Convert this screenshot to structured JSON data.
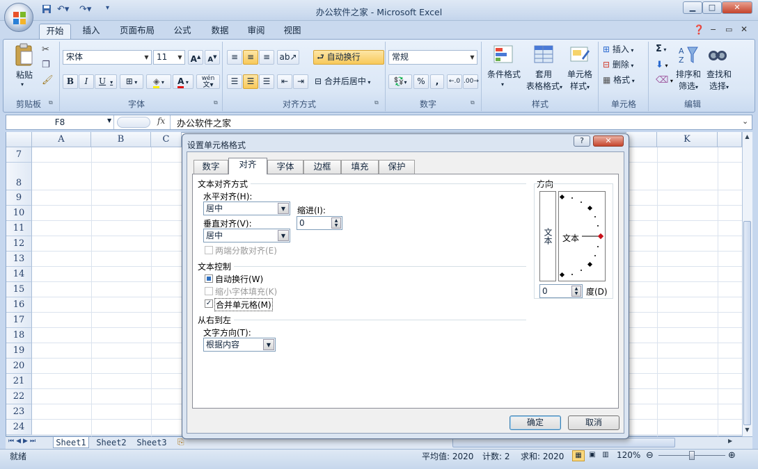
{
  "window": {
    "title": "办公软件之家 - Microsoft Excel"
  },
  "ribbon_tabs": [
    "开始",
    "插入",
    "页面布局",
    "公式",
    "数据",
    "审阅",
    "视图"
  ],
  "clipboard": {
    "paste": "粘贴",
    "group": "剪贴板"
  },
  "font": {
    "name": "宋体",
    "size": "11",
    "bold": "B",
    "italic": "I",
    "underline": "U",
    "phonetic": "wén",
    "group": "字体"
  },
  "alignment": {
    "wrap": "自动换行",
    "merge": "合并后居中",
    "group": "对齐方式"
  },
  "number": {
    "format": "常规",
    "percent": "%",
    "comma": ",",
    "group": "数字"
  },
  "styles": {
    "conditional1": "条件格式",
    "table1": "套用",
    "table2": "表格格式",
    "cell1": "单元格",
    "cell2": "样式",
    "group": "样式"
  },
  "cells": {
    "insert": "插入",
    "delete": "删除",
    "format": "格式",
    "group": "单元格"
  },
  "editing": {
    "sigma": "Σ",
    "sort1": "排序和",
    "sort2": "筛选",
    "find1": "查找和",
    "find2": "选择",
    "group": "编辑"
  },
  "formula_bar": {
    "name_box": "F8",
    "fx": "fx",
    "content": "办公软件之家"
  },
  "columns": [
    "A",
    "B",
    "C",
    "K"
  ],
  "rows": [
    "7",
    "8",
    "9",
    "10",
    "11",
    "12",
    "13",
    "14",
    "15",
    "16",
    "17",
    "18",
    "19",
    "20",
    "21",
    "22",
    "23",
    "24"
  ],
  "sheets": [
    "Sheet1",
    "Sheet2",
    "Sheet3"
  ],
  "status": {
    "ready": "就绪",
    "average": "平均值: 2020",
    "count": "计数: 2",
    "sum": "求和: 2020",
    "zoom": "120%"
  },
  "dialog": {
    "title": "设置单元格格式",
    "help": "?",
    "tabs": [
      "数字",
      "对齐",
      "字体",
      "边框",
      "填充",
      "保护"
    ],
    "active_tab": "对齐",
    "text_align_heading": "文本对齐方式",
    "horizontal_label": "水平对齐(H):",
    "horizontal_value": "居中",
    "indent_label": "缩进(I):",
    "indent_value": "0",
    "vertical_label": "垂直对齐(V):",
    "vertical_value": "居中",
    "justify_distributed": "两端分散对齐(E)",
    "text_control_heading": "文本控制",
    "wrap_text": "自动换行(W)",
    "wrap_text_checked": true,
    "shrink_to_fit": "缩小字体填充(K)",
    "merge_cells": "合并单元格(M)",
    "merge_cells_checked": true,
    "rtl_heading": "从右到左",
    "text_direction_label": "文字方向(T):",
    "text_direction_value": "根据内容",
    "orientation_heading": "方向",
    "orientation_vertical_text": "文本",
    "orientation_text": "文本",
    "degrees_value": "0",
    "degrees_label": "度(D)",
    "ok": "确定",
    "cancel": "取消"
  }
}
